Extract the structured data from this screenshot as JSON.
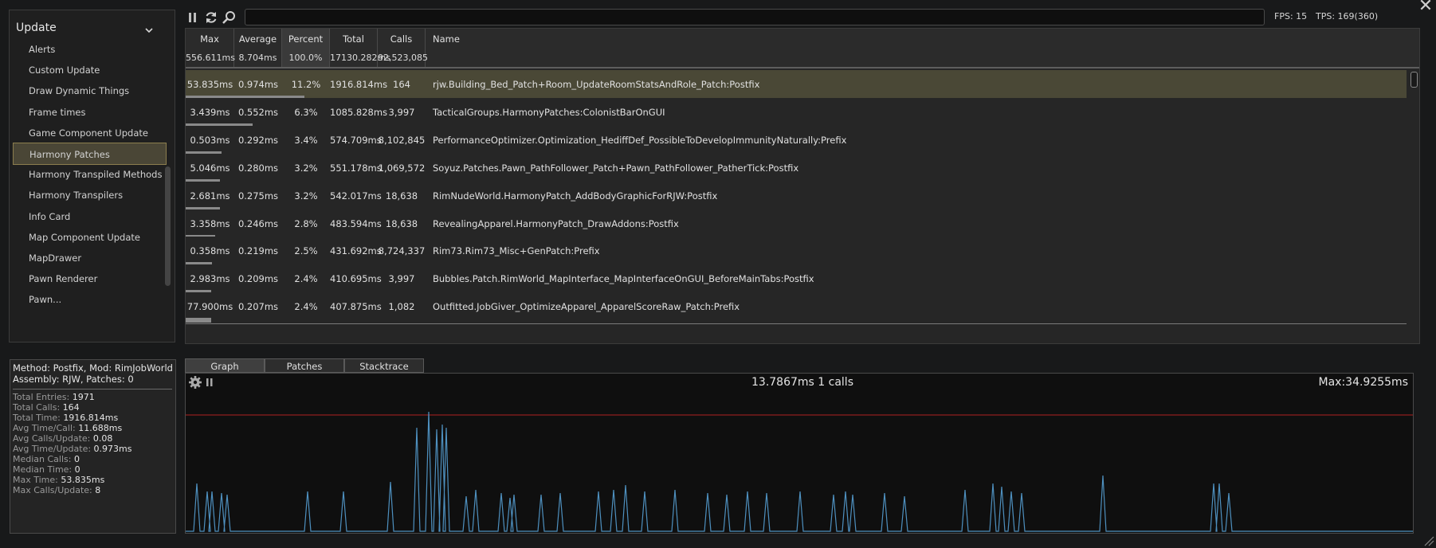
{
  "close_label": "✕",
  "category_panel": {
    "title": "Update",
    "items": [
      {
        "label": "Alerts",
        "active": false
      },
      {
        "label": "Custom Update",
        "active": false
      },
      {
        "label": "Draw Dynamic Things",
        "active": false
      },
      {
        "label": "Frame times",
        "active": false
      },
      {
        "label": "Game Component Update",
        "active": false
      },
      {
        "label": "Harmony Patches",
        "active": true
      },
      {
        "label": "Harmony Transpiled Methods",
        "active": false
      },
      {
        "label": "Harmony Transpilers",
        "active": false
      },
      {
        "label": "Info Card",
        "active": false
      },
      {
        "label": "Map Component Update",
        "active": false
      },
      {
        "label": "MapDrawer",
        "active": false
      },
      {
        "label": "Pawn Renderer",
        "active": false
      },
      {
        "label": "Pawn...",
        "active": false
      }
    ]
  },
  "toolbar": {
    "search_value": "",
    "fps": "FPS: 15",
    "tps": "TPS: 169(360)"
  },
  "table": {
    "headers": [
      {
        "label": "Max",
        "value": "556.611ms"
      },
      {
        "label": "Average",
        "value": "8.704ms"
      },
      {
        "label": "Percent",
        "value": "100.0%"
      },
      {
        "label": "Total",
        "value": "17130.282ms"
      },
      {
        "label": "Calls",
        "value": "92,523,085"
      },
      {
        "label": "Name",
        "value": ""
      }
    ],
    "sorted_column": "Percent",
    "rows": [
      {
        "max": "53.835ms",
        "avg": "0.974ms",
        "pct": "11.2%",
        "total": "1916.814ms",
        "calls": "164",
        "name": "rjw.Building_Bed_Patch+Room_UpdateRoomStatsAndRole_Patch:Postfix",
        "bar": 0.112,
        "highlighted": true
      },
      {
        "max": "3.439ms",
        "avg": "0.552ms",
        "pct": "6.3%",
        "total": "1085.828ms",
        "calls": "3,997",
        "name": "TacticalGroups.HarmonyPatches:ColonistBarOnGUI",
        "bar": 0.063,
        "highlighted": false
      },
      {
        "max": "0.503ms",
        "avg": "0.292ms",
        "pct": "3.4%",
        "total": "574.709ms",
        "calls": "8,102,845",
        "name": "PerformanceOptimizer.Optimization_HediffDef_PossibleToDevelopImmunityNaturally:Prefix",
        "bar": 0.034,
        "highlighted": false
      },
      {
        "max": "5.046ms",
        "avg": "0.280ms",
        "pct": "3.2%",
        "total": "551.178ms",
        "calls": "1,069,572",
        "name": "Soyuz.Patches.Pawn_PathFollower_Patch+Pawn_PathFollower_PatherTick:Postfix",
        "bar": 0.032,
        "highlighted": false
      },
      {
        "max": "2.681ms",
        "avg": "0.275ms",
        "pct": "3.2%",
        "total": "542.017ms",
        "calls": "18,638",
        "name": "RimNudeWorld.HarmonyPatch_AddBodyGraphicForRJW:Postfix",
        "bar": 0.032,
        "highlighted": false
      },
      {
        "max": "3.358ms",
        "avg": "0.246ms",
        "pct": "2.8%",
        "total": "483.594ms",
        "calls": "18,638",
        "name": "RevealingApparel.HarmonyPatch_DrawAddons:Postfix",
        "bar": 0.028,
        "highlighted": false
      },
      {
        "max": "0.358ms",
        "avg": "0.219ms",
        "pct": "2.5%",
        "total": "431.692ms",
        "calls": "8,724,337",
        "name": "Rim73.Rim73_Misc+GenPatch:Prefix",
        "bar": 0.025,
        "highlighted": false
      },
      {
        "max": "2.983ms",
        "avg": "0.209ms",
        "pct": "2.4%",
        "total": "410.695ms",
        "calls": "3,997",
        "name": "Bubbles.Patch.RimWorld_MapInterface_MapInterfaceOnGUI_BeforeMainTabs:Postfix",
        "bar": 0.024,
        "highlighted": false
      },
      {
        "max": "77.900ms",
        "avg": "0.207ms",
        "pct": "2.4%",
        "total": "407.875ms",
        "calls": "1,082",
        "name": "Outfitted.JobGiver_OptimizeApparel_ApparelScoreRaw_Patch:Prefix",
        "bar": 0.024,
        "highlighted": false
      }
    ]
  },
  "info": {
    "method_line": "Method: Postfix, Mod: RimJobWorld",
    "assembly_line": "Assembly: RJW, Patches: 0",
    "stats": [
      {
        "label": "Total Entries:",
        "value": "1971"
      },
      {
        "label": "Total Calls:",
        "value": "164"
      },
      {
        "label": "Total Time:",
        "value": "1916.814ms"
      },
      {
        "label": "Avg Time/Call:",
        "value": "11.688ms"
      },
      {
        "label": "Avg Calls/Update:",
        "value": "0.08"
      },
      {
        "label": "Avg Time/Update:",
        "value": "0.973ms"
      },
      {
        "label": "Median Calls:",
        "value": "0"
      },
      {
        "label": "Median Time:",
        "value": "0"
      },
      {
        "label": "Max Time:",
        "value": "53.835ms"
      },
      {
        "label": "Max Calls/Update:",
        "value": "8"
      }
    ]
  },
  "tabs": [
    {
      "label": "Graph",
      "active": true
    },
    {
      "label": "Patches",
      "active": false
    },
    {
      "label": "Stacktrace",
      "active": false
    }
  ],
  "graph": {
    "center_label": "13.7867ms 1 calls",
    "max_label": "Max:34.9255ms",
    "line_color": "#4e90bf",
    "threshold_color": "#b02020",
    "icon_names": [
      "gear-icon",
      "pause-icon"
    ]
  },
  "colors": {
    "highlight_row": "#4a4836",
    "active_item_border": "#8c7e4e"
  }
}
